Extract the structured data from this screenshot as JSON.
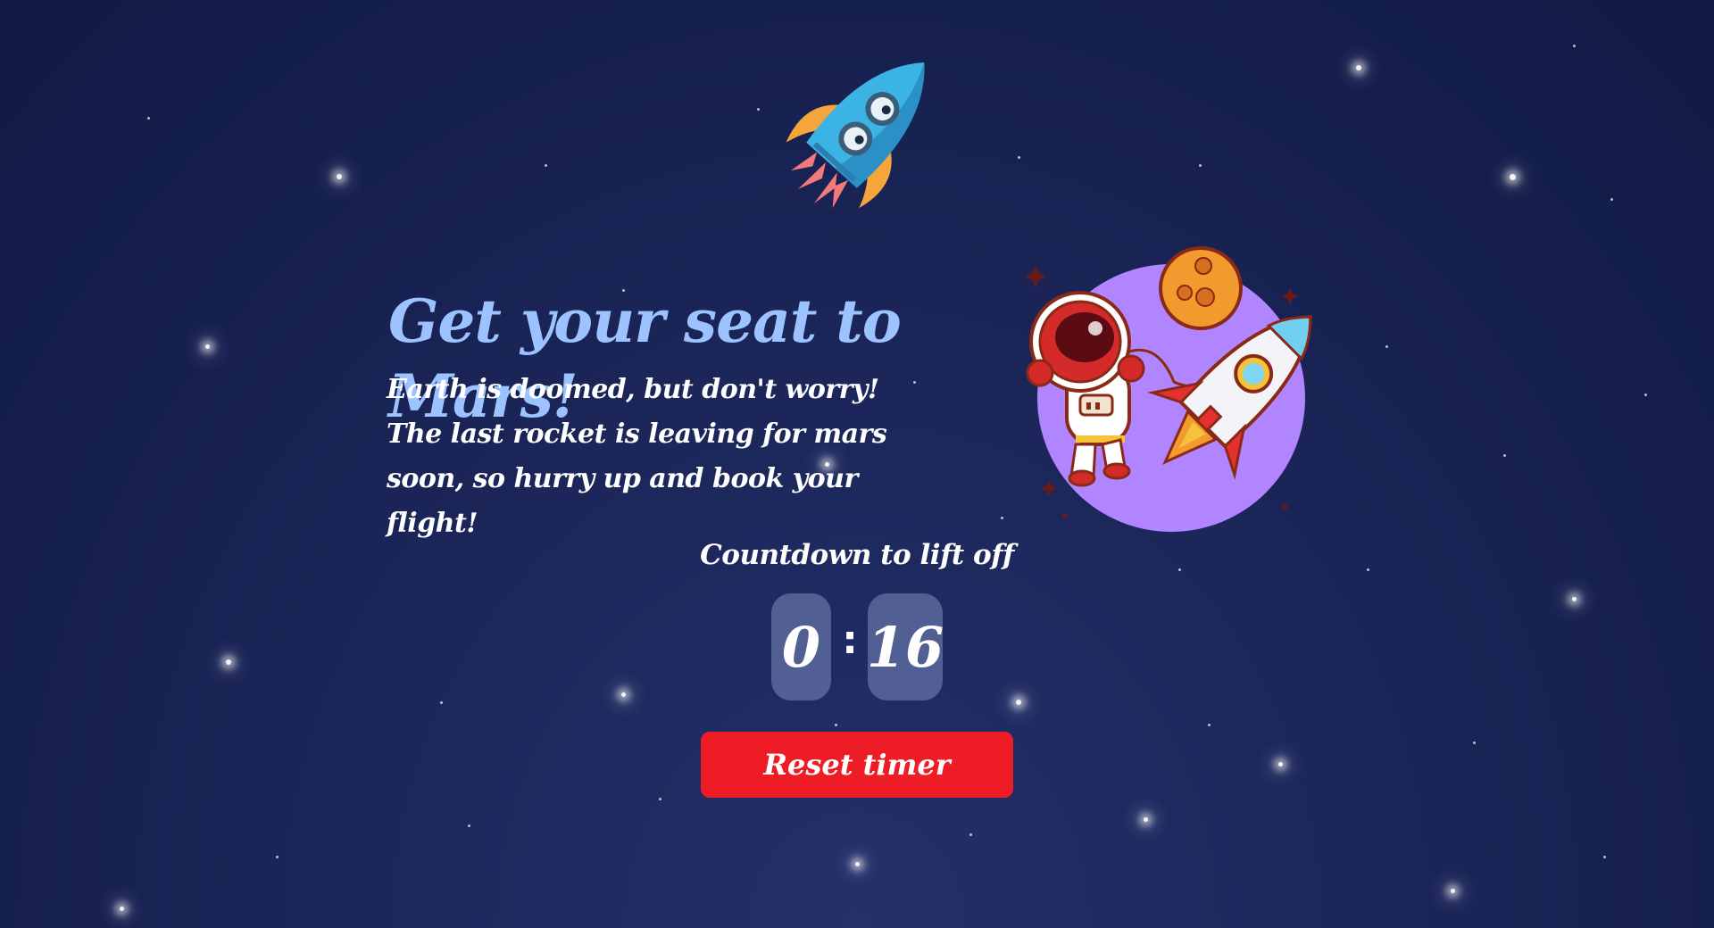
{
  "hero": {
    "title": "Get your seat to Mars!",
    "description": "Earth is doomed, but don't worry! The last rocket is leaving for mars soon, so hurry up and book your flight!"
  },
  "countdown": {
    "title": "Countdown to lift off",
    "minutes": "0",
    "separator": ":",
    "seconds": "16"
  },
  "reset_button": {
    "label": "Reset timer"
  },
  "colors": {
    "background": "#1b2558",
    "headline": "#9cc3ff",
    "button": "#ee1c25",
    "digit_box": "#7c8abe",
    "planet": "#b085ff"
  },
  "illustrations": {
    "top": "rocket-icon",
    "hero": "astronaut-planet-rocket-illustration"
  }
}
